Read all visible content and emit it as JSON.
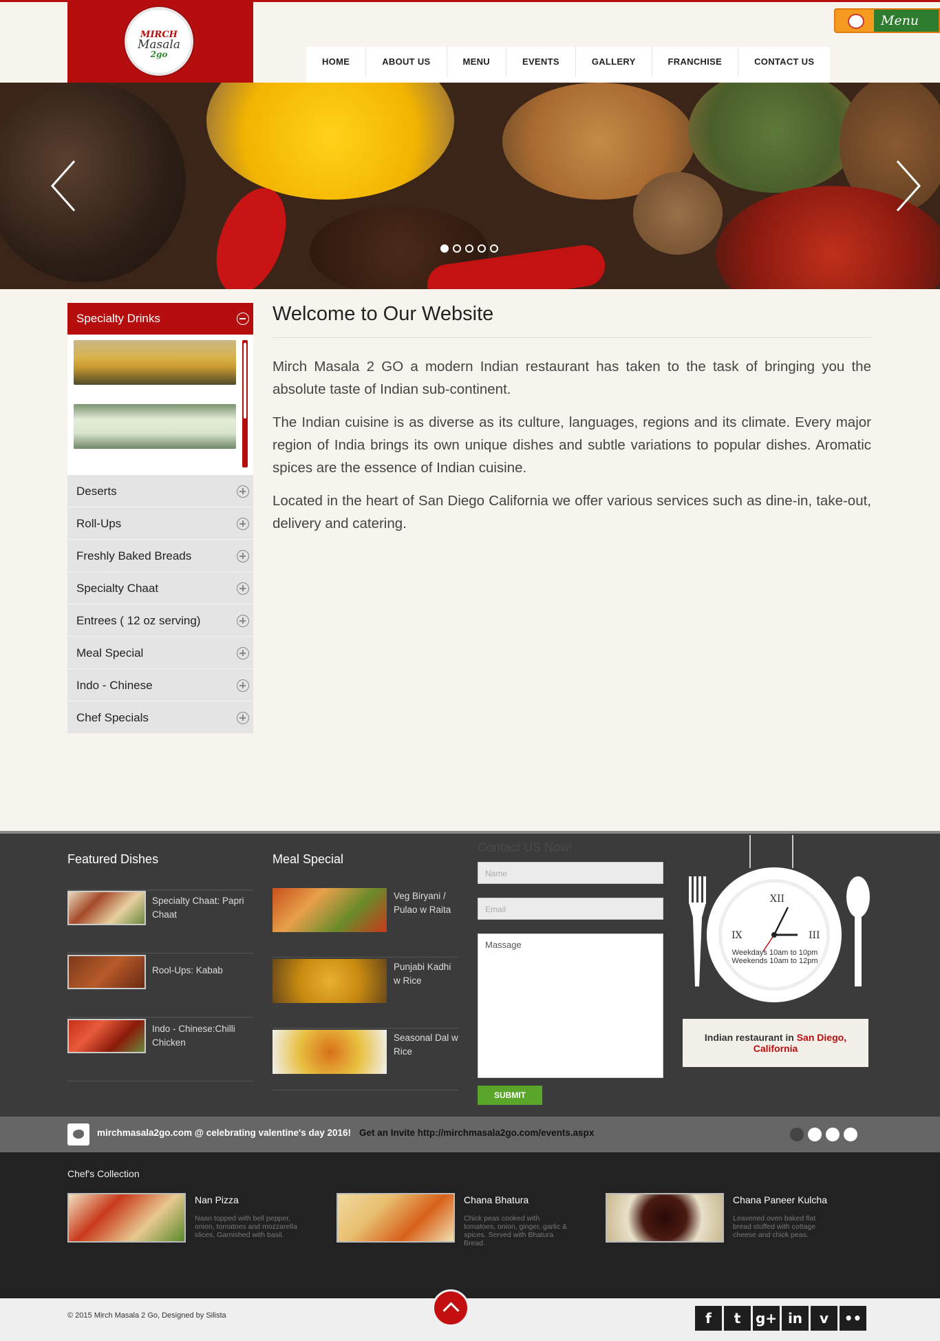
{
  "brand": {
    "logo_line1": "MIRCH",
    "logo_line2": "Masala",
    "logo_line3": "2go",
    "menu_tab": "Menu"
  },
  "nav": {
    "items": [
      "HOME",
      "ABOUT US",
      "MENU",
      "EVENTS",
      "GALLERY",
      "FRANCHISE",
      "CONTACT US"
    ]
  },
  "hero": {
    "slides": 5,
    "active_slide": 1
  },
  "sidebar": {
    "active": "Specialty Drinks",
    "items": [
      "Deserts",
      "Roll-Ups",
      "Freshly Baked Breads",
      "Specialty Chaat",
      "Entrees ( 12 oz serving)",
      "Meal Special",
      "Indo - Chinese",
      "Chef Specials"
    ]
  },
  "welcome": {
    "title": "Welcome to Our Website",
    "paragraphs": [
      "Mirch Masala 2 GO a modern Indian restaurant has taken to the task of bringing you the absolute taste of Indian sub-continent.",
      "The Indian cuisine is as diverse as its culture, languages, regions and its climate. Every major region of India brings its own unique dishes and subtle variations to popular dishes. Aromatic spices are the essence of Indian cuisine.",
      "Located in the heart of San Diego California we offer various services such as dine-in, take-out, delivery and catering."
    ]
  },
  "featured": {
    "heading": "Featured Dishes",
    "items": [
      "Specialty Chaat: Papri Chaat",
      "Rool-Ups: Kabab",
      "Indo - Chinese:Chilli Chicken"
    ]
  },
  "meal_special": {
    "heading": "Meal Special",
    "items": [
      "Veg Biryani / Pulao w Raita",
      "Punjabi Kadhi w Rice",
      "Seasonal Dal w Rice"
    ]
  },
  "contact": {
    "heading": "Contact US Now!",
    "name_placeholder": "Name",
    "email_placeholder": "Email",
    "message_placeholder": "Massage",
    "submit": "SUBMIT"
  },
  "hours": {
    "line1": "Weekdays 10am to 10pm",
    "line2": "Weekends 10am to 12pm"
  },
  "location": {
    "prefix": "Indian restaurant in",
    "place": "San Diego, California"
  },
  "tweet": {
    "text": "mirchmasala2go.com @ celebrating valentine's day 2016!",
    "invite": "Get an Invite http://mirchmasala2go.com/events.aspx",
    "dots": 4,
    "active_dot": 1
  },
  "chefs": {
    "heading": "Chef's Collection",
    "items": [
      {
        "name": "Nan Pizza",
        "desc": "Naan topped with bell pepper, onion, tomatoes and mozzarella slices, Garnished with basil."
      },
      {
        "name": "Chana Bhatura",
        "desc": "Chick peas cooked with tomatoes, onion, ginger, garlic & spices. Served with Bhatura Bread."
      },
      {
        "name": "Chana Paneer Kulcha",
        "desc": "Leavened oven baked flat bread stuffed with cottage cheese and chick peas."
      }
    ]
  },
  "footer": {
    "copyright": "© 2015 Mirch Masala 2 Go, Designed by Silista"
  },
  "social": [
    "f",
    "t",
    "g+",
    "in",
    "v",
    "••"
  ],
  "colors": {
    "brand_red": "#b60e0e",
    "submit_green": "#5aa62a",
    "footer_dark": "#3b3b3b"
  }
}
